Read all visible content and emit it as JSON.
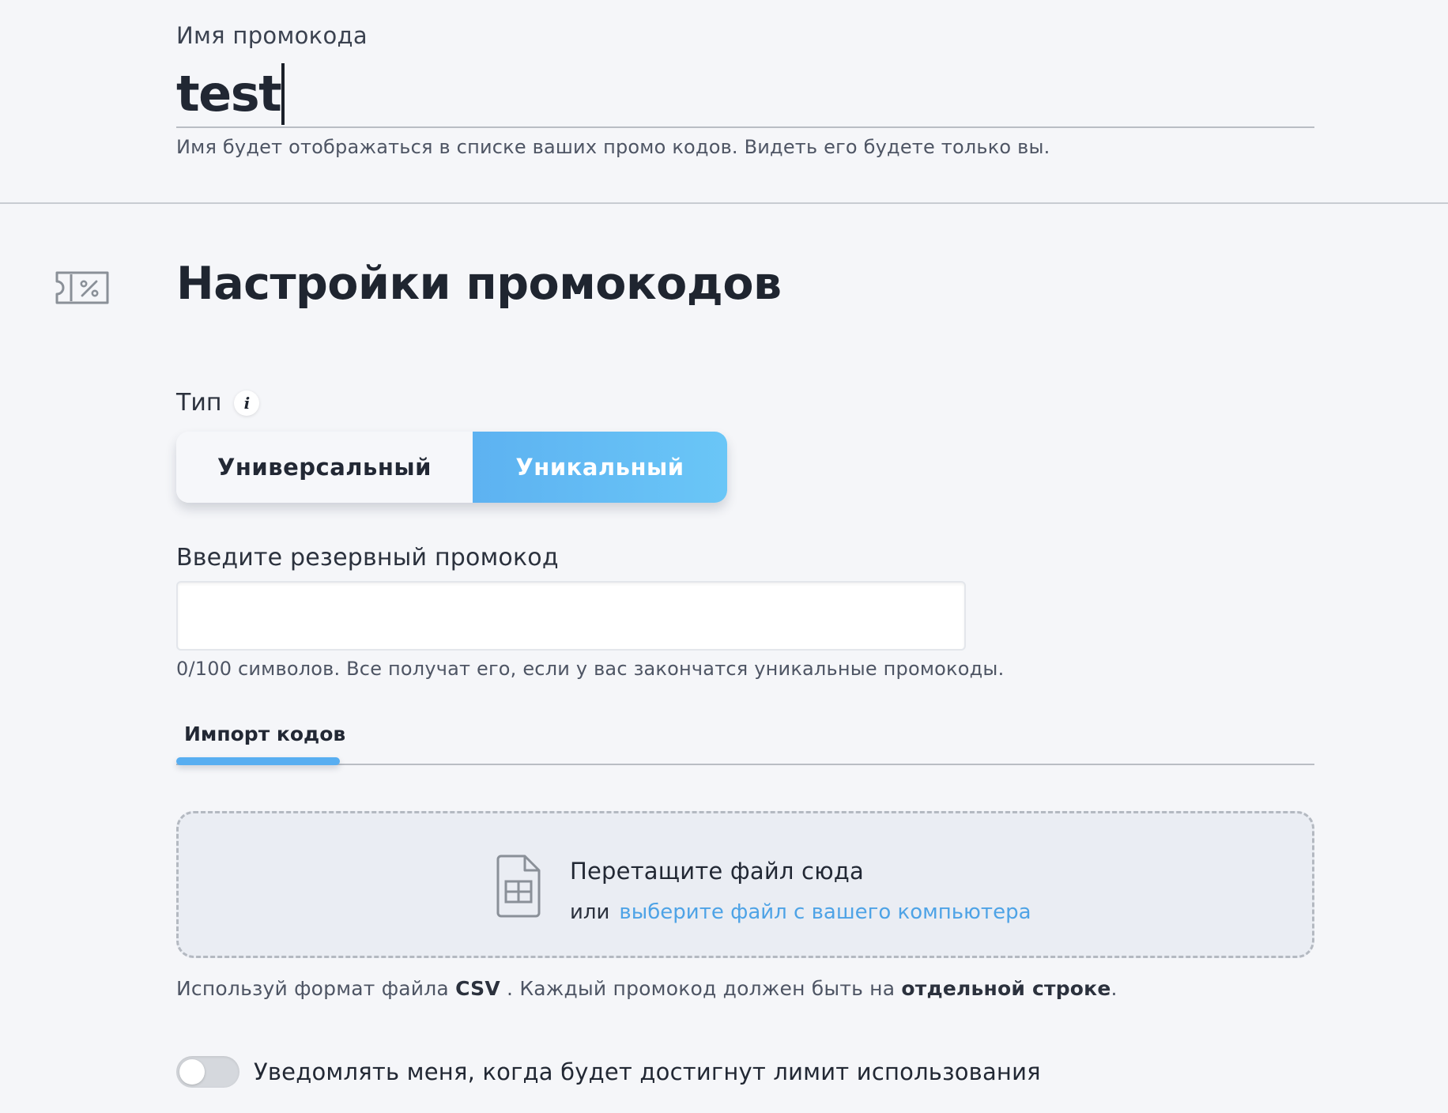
{
  "promo_name": {
    "label": "Имя промокода",
    "value": "test",
    "hint": "Имя будет отображаться в списке ваших промо кодов. Видеть его будете только вы."
  },
  "section": {
    "title": "Настройки промокодов",
    "icon": "ticket-percent-icon"
  },
  "type": {
    "label": "Тип",
    "info_icon": "i",
    "options": [
      {
        "label": "Универсальный",
        "selected": false
      },
      {
        "label": "Уникальный",
        "selected": true
      }
    ],
    "accent_color": "#5db2f1"
  },
  "reserve": {
    "label": "Введите резервный промокод",
    "value": "",
    "placeholder": "",
    "hint": "0/100 символов. Все получат его, если у вас закончатся уникальные промокоды."
  },
  "tabs": {
    "items": [
      {
        "label": "Импорт кодов",
        "active": true
      }
    ]
  },
  "dropzone": {
    "title": "Перетащите файл сюда",
    "or": "или",
    "link": "выберите файл с вашего компьютера",
    "link_color": "#4ea3e6"
  },
  "format_hint": {
    "prefix": "Используй формат файла ",
    "format": "CSV",
    "middle": " . Каждый промокод должен быть на ",
    "emphasis": "отдельной строке",
    "suffix": "."
  },
  "notify": {
    "label": "Уведомлять меня, когда будет достигнут лимит использования",
    "enabled": false
  }
}
